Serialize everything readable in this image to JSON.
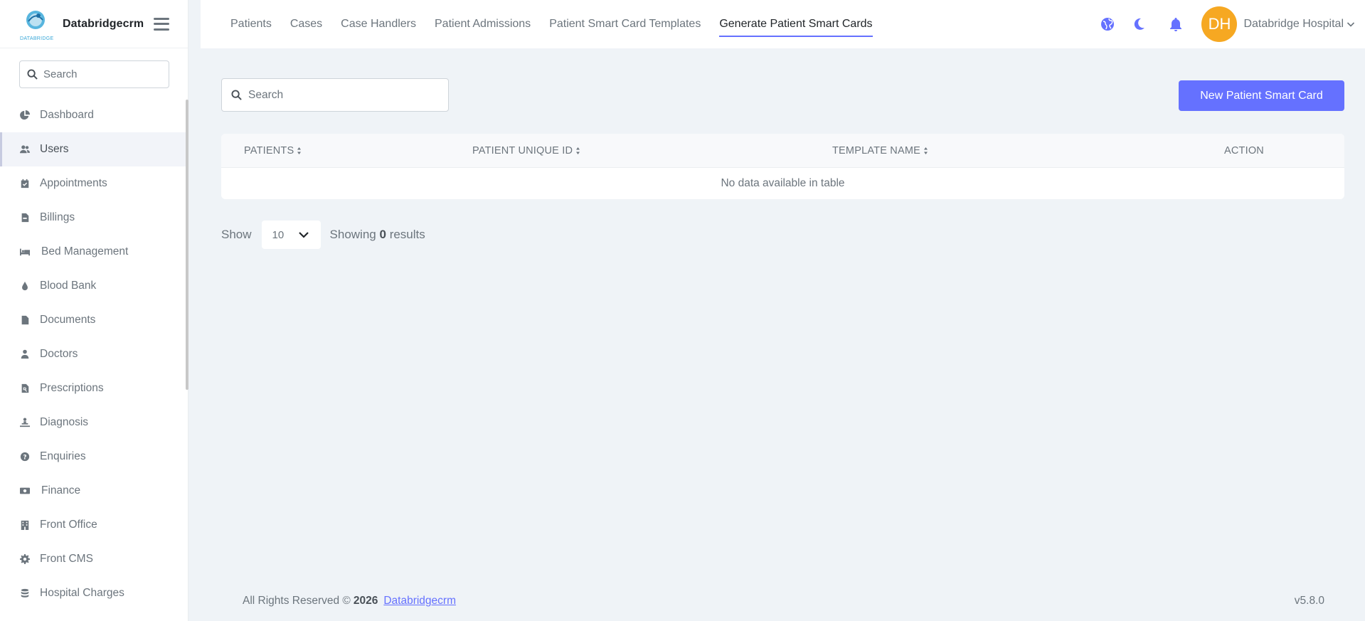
{
  "brand": {
    "name": "Databridgecrm",
    "logo_text": "DATABRIDGE"
  },
  "sidebar": {
    "search_placeholder": "Search",
    "items": [
      {
        "label": "Dashboard",
        "icon": "pie-chart-icon"
      },
      {
        "label": "Users",
        "icon": "users-icon",
        "active": true
      },
      {
        "label": "Appointments",
        "icon": "calendar-check-icon"
      },
      {
        "label": "Billings",
        "icon": "file-invoice-icon"
      },
      {
        "label": "Bed Management",
        "icon": "bed-icon"
      },
      {
        "label": "Blood Bank",
        "icon": "droplet-icon"
      },
      {
        "label": "Documents",
        "icon": "file-icon"
      },
      {
        "label": "Doctors",
        "icon": "user-doctor-icon"
      },
      {
        "label": "Prescriptions",
        "icon": "file-prescription-icon"
      },
      {
        "label": "Diagnosis",
        "icon": "diagnoses-icon"
      },
      {
        "label": "Enquiries",
        "icon": "question-circle-icon"
      },
      {
        "label": "Finance",
        "icon": "money-bill-icon"
      },
      {
        "label": "Front Office",
        "icon": "building-icon"
      },
      {
        "label": "Front CMS",
        "icon": "gear-icon"
      },
      {
        "label": "Hospital Charges",
        "icon": "coins-icon"
      }
    ]
  },
  "topnav": {
    "tabs": [
      {
        "label": "Patients"
      },
      {
        "label": "Cases"
      },
      {
        "label": "Case Handlers"
      },
      {
        "label": "Patient Admissions"
      },
      {
        "label": "Patient Smart Card Templates"
      },
      {
        "label": "Generate Patient Smart Cards",
        "active": true
      }
    ],
    "user_initials": "DH",
    "user_name": "Databridge Hospital"
  },
  "main": {
    "search_placeholder": "Search",
    "new_button": "New Patient Smart Card",
    "columns": [
      "PATIENTS",
      "PATIENT UNIQUE ID",
      "TEMPLATE NAME",
      "ACTION"
    ],
    "empty_text": "No data available in table",
    "show_label": "Show",
    "page_size": "10",
    "showing_prefix": "Showing",
    "showing_count": "0",
    "showing_suffix": "results"
  },
  "footer": {
    "copyright": "All Rights Reserved ©",
    "year": "2026",
    "link": "Databridgecrm",
    "version": "v5.8.0"
  },
  "colors": {
    "accent": "#6571ff",
    "avatar": "#f6a822",
    "background": "#eff3f7"
  }
}
